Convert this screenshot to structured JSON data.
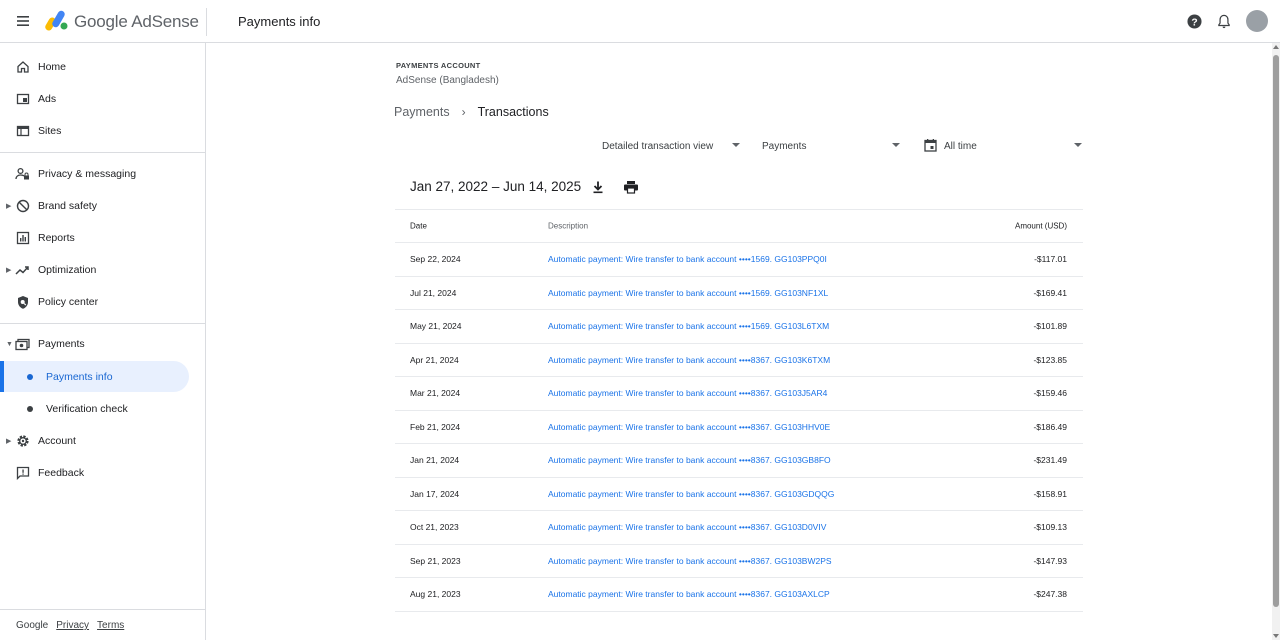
{
  "header": {
    "brand_google": "Google",
    "brand_product": "AdSense",
    "page_title": "Payments info",
    "icons": [
      "menu-icon",
      "help-icon",
      "bell-icon",
      "avatar"
    ]
  },
  "sidebar": {
    "items": [
      {
        "label": "Home",
        "icon": "home-icon"
      },
      {
        "label": "Ads",
        "icon": "ads-icon"
      },
      {
        "label": "Sites",
        "icon": "sites-icon"
      },
      {
        "label": "Privacy & messaging",
        "icon": "privacy-icon"
      },
      {
        "label": "Brand safety",
        "icon": "block-icon"
      },
      {
        "label": "Reports",
        "icon": "reports-icon"
      },
      {
        "label": "Optimization",
        "icon": "trending-icon"
      },
      {
        "label": "Policy center",
        "icon": "policy-icon"
      },
      {
        "label": "Payments",
        "icon": "payments-icon"
      },
      {
        "label": "Payments info",
        "icon": "dot"
      },
      {
        "label": "Verification check",
        "icon": "dot"
      },
      {
        "label": "Account",
        "icon": "gear-icon"
      },
      {
        "label": "Feedback",
        "icon": "feedback-icon"
      }
    ],
    "footer": {
      "google": "Google",
      "privacy": "Privacy",
      "terms": "Terms"
    }
  },
  "main": {
    "account_label": "PAYMENTS ACCOUNT",
    "account_name": "AdSense (Bangladesh)",
    "breadcrumb": {
      "parent": "Payments",
      "current": "Transactions"
    },
    "filters": {
      "view": "Detailed transaction view",
      "type": "Payments",
      "period": "All time"
    },
    "date_range": "Jan 27, 2022 – Jun 14, 2025",
    "table": {
      "headers": {
        "date": "Date",
        "description": "Description",
        "amount": "Amount (USD)"
      },
      "rows": [
        {
          "date": "Sep 22, 2024",
          "description": "Automatic payment: Wire transfer to bank account ••••1569. GG103PPQ0I",
          "amount": "-$117.01"
        },
        {
          "date": "Jul 21, 2024",
          "description": "Automatic payment: Wire transfer to bank account ••••1569. GG103NF1XL",
          "amount": "-$169.41"
        },
        {
          "date": "May 21, 2024",
          "description": "Automatic payment: Wire transfer to bank account ••••1569. GG103L6TXM",
          "amount": "-$101.89"
        },
        {
          "date": "Apr 21, 2024",
          "description": "Automatic payment: Wire transfer to bank account ••••8367. GG103K6TXM",
          "amount": "-$123.85"
        },
        {
          "date": "Mar 21, 2024",
          "description": "Automatic payment: Wire transfer to bank account ••••8367. GG103J5AR4",
          "amount": "-$159.46"
        },
        {
          "date": "Feb 21, 2024",
          "description": "Automatic payment: Wire transfer to bank account ••••8367. GG103HHV0E",
          "amount": "-$186.49"
        },
        {
          "date": "Jan 21, 2024",
          "description": "Automatic payment: Wire transfer to bank account ••••8367. GG103GB8FO",
          "amount": "-$231.49"
        },
        {
          "date": "Jan 17, 2024",
          "description": "Automatic payment: Wire transfer to bank account ••••8367. GG103GDQQG",
          "amount": "-$158.91"
        },
        {
          "date": "Oct 21, 2023",
          "description": "Automatic payment: Wire transfer to bank account ••••8367. GG103D0VIV",
          "amount": "-$109.13"
        },
        {
          "date": "Sep 21, 2023",
          "description": "Automatic payment: Wire transfer to bank account ••••8367. GG103BW2PS",
          "amount": "-$147.93"
        },
        {
          "date": "Aug 21, 2023",
          "description": "Automatic payment: Wire transfer to bank account ••••8367. GG103AXLCP",
          "amount": "-$247.38"
        }
      ]
    }
  },
  "colors": {
    "accent": "#1a73e8",
    "active_bg": "#e8f0fe",
    "logo_yellow": "#fbbc04",
    "logo_blue": "#4285f4",
    "logo_green": "#34a853"
  }
}
